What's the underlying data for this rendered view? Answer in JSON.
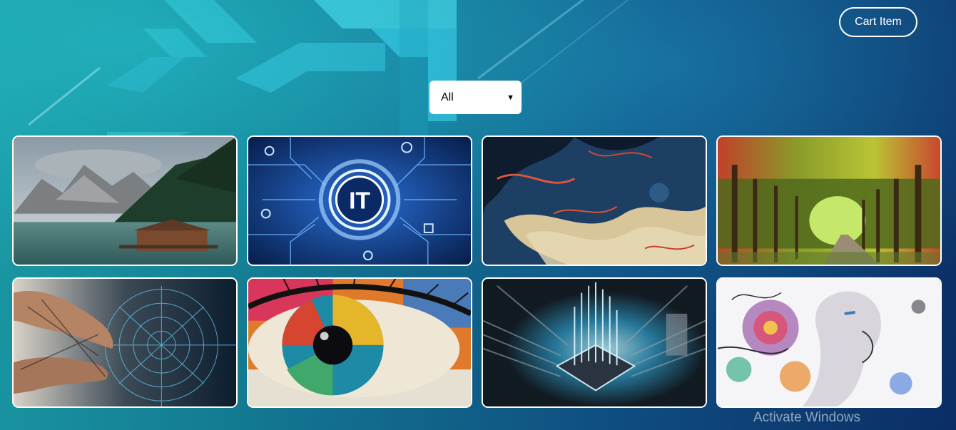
{
  "header": {
    "cart_button_label": "Cart Item"
  },
  "filter": {
    "selected": "All"
  },
  "gallery": {
    "items": [
      {
        "subject": "mountain-lake"
      },
      {
        "subject": "it-circuit"
      },
      {
        "subject": "abstract-fluid"
      },
      {
        "subject": "forest-path"
      },
      {
        "subject": "digital-hands"
      },
      {
        "subject": "painted-eye"
      },
      {
        "subject": "processor-chip"
      },
      {
        "subject": "floral-face-art"
      }
    ]
  },
  "overlay": {
    "watermark": "Activate Windows"
  },
  "colors": {
    "background_start": "#1a9aa4",
    "background_end": "#0b2d66",
    "card_border": "#ffffff"
  }
}
